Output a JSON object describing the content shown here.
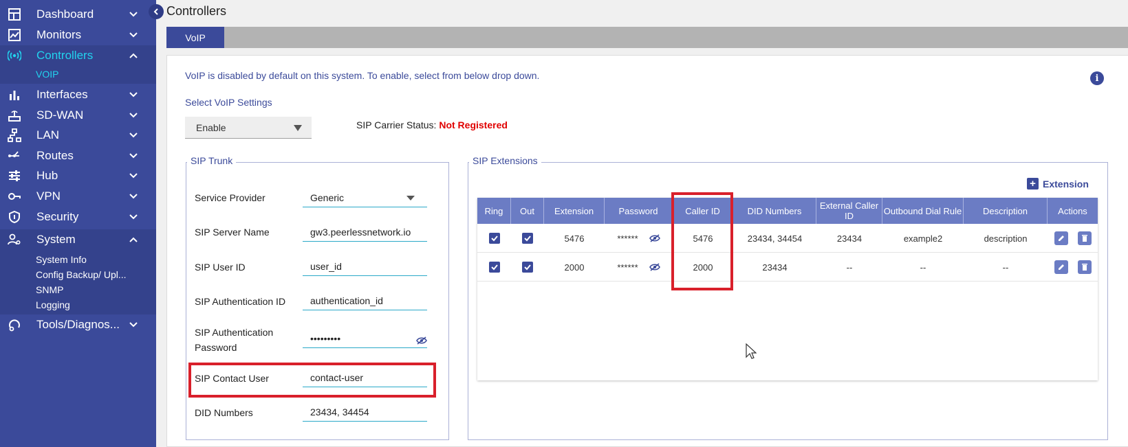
{
  "sidebar": {
    "items": [
      {
        "label": "Dashboard"
      },
      {
        "label": "Monitors"
      },
      {
        "label": "Controllers"
      },
      {
        "label": "Interfaces"
      },
      {
        "label": "SD-WAN"
      },
      {
        "label": "LAN"
      },
      {
        "label": "Routes"
      },
      {
        "label": "Hub"
      },
      {
        "label": "VPN"
      },
      {
        "label": "Security"
      },
      {
        "label": "System"
      },
      {
        "label": "Tools/Diagnos..."
      }
    ],
    "controllers_sub": [
      "VOIP"
    ],
    "system_sub": [
      "System Info",
      "Config Backup/ Upl...",
      "SNMP",
      "Logging"
    ]
  },
  "page": {
    "title": "Controllers",
    "tab": "VoIP",
    "notice": "VoIP is disabled by default on this system. To enable, select from below drop down.",
    "select_label": "Select VoIP Settings",
    "select_value": "Enable",
    "carrier_label": "SIP Carrier Status:",
    "carrier_value": "Not Registered"
  },
  "trunk": {
    "legend": "SIP Trunk",
    "fields": [
      {
        "label": "Service Provider",
        "value": "Generic"
      },
      {
        "label": "SIP Server Name",
        "value": "gw3.peerlessnetwork.io"
      },
      {
        "label": "SIP User ID",
        "value": "user_id"
      },
      {
        "label": "SIP Authentication ID",
        "value": "authentication_id"
      },
      {
        "label_line1": "SIP Authentication",
        "label_line2": "Password",
        "value": "•••••••••"
      },
      {
        "label": "SIP Contact User",
        "value": "contact-user"
      },
      {
        "label": "DID Numbers",
        "value": "23434, 34454"
      }
    ]
  },
  "extensions": {
    "legend": "SIP Extensions",
    "add_label": "Extension",
    "columns": [
      "Ring",
      "Out",
      "Extension",
      "Password",
      "Caller ID",
      "DID Numbers",
      "External Caller ID",
      "Outbound Dial Rule",
      "Description",
      "Actions"
    ],
    "rows": [
      {
        "ring": true,
        "out": true,
        "extension": "5476",
        "password": "******",
        "caller_id": "5476",
        "did": "23434, 34454",
        "external": "23434",
        "rule": "example2",
        "description": "description"
      },
      {
        "ring": true,
        "out": true,
        "extension": "2000",
        "password": "******",
        "caller_id": "2000",
        "did": "23434",
        "external": "--",
        "rule": "--",
        "description": "--"
      }
    ]
  },
  "colors": {
    "sidebar": "#3b4a9a",
    "accent": "#22d3ee",
    "header": "#6b7cc4",
    "highlight": "#d9202b",
    "error": "#e00000"
  }
}
